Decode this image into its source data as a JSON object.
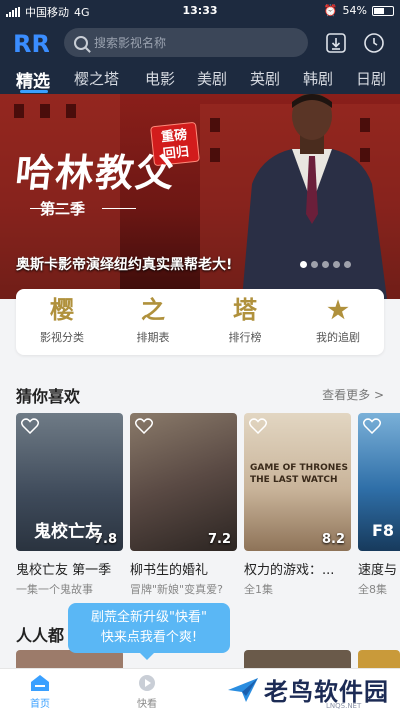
{
  "status_bar": {
    "carrier": "中国移动",
    "network": "4G",
    "time": "13:33",
    "battery": "54%"
  },
  "header": {
    "logo_text": "RR",
    "search_placeholder": "搜索影视名称"
  },
  "tabs": [
    {
      "label": "精选",
      "active": true
    },
    {
      "label": "樱之塔"
    },
    {
      "label": "电影"
    },
    {
      "label": "美剧"
    },
    {
      "label": "英剧"
    },
    {
      "label": "韩剧"
    },
    {
      "label": "日剧"
    }
  ],
  "banner": {
    "title": "哈林教父",
    "season": "第二季",
    "tag_line1": "重磅",
    "tag_line2": "回归",
    "caption": "奥斯卡影帝演绎纽约真实黑帮老大!"
  },
  "quick_nav": [
    {
      "glyph": "樱",
      "label": "影视分类"
    },
    {
      "glyph": "之",
      "label": "排期表"
    },
    {
      "glyph": "塔",
      "label": "排行榜"
    },
    {
      "glyph": "★",
      "label": "我的追剧"
    }
  ],
  "recommend": {
    "title": "猜你喜欢",
    "more": "查看更多 >",
    "items": [
      {
        "title": "鬼校亡友 第一季",
        "subtitle": "一集一个鬼故事",
        "score": "7.8",
        "poster_text": "鬼校亡友",
        "poster_color": "#3e4a5a"
      },
      {
        "title": "柳书生的婚礼",
        "subtitle": "冒牌\"新娘\"变真爱?",
        "score": "7.2",
        "poster_color": "#5a4a44"
      },
      {
        "title": "权力的游戏：...",
        "subtitle": "全1集",
        "score": "8.2",
        "poster_text1": "GAME OF THRONES",
        "poster_text2": "THE LAST WATCH",
        "poster_color": "#c9b49a"
      },
      {
        "title": "速度与",
        "subtitle": "全8集",
        "poster_text": "F8",
        "poster_color": "#2f6fa8"
      }
    ]
  },
  "second_section": {
    "title": "人人都"
  },
  "tooltip": {
    "line1": "剧荒全新升级\"快看\"",
    "line2": "快来点我看个爽!"
  },
  "bottom_nav": [
    {
      "label": "首页",
      "active": true
    },
    {
      "label": "快看"
    }
  ],
  "watermark": {
    "text": "老鸟软件园",
    "sub": "LNQS.NET"
  },
  "colors": {
    "header_bg": "#1d2a3f",
    "accent": "#3aa0ff",
    "tooltip": "#5ab7f5",
    "gold": "#b0913c"
  }
}
